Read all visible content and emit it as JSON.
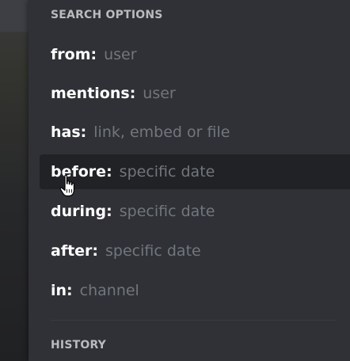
{
  "search_options": {
    "header": "SEARCH OPTIONS",
    "items": [
      {
        "key": "from:",
        "hint": "user"
      },
      {
        "key": "mentions:",
        "hint": "user"
      },
      {
        "key": "has:",
        "hint": "link, embed or file"
      },
      {
        "key": "before:",
        "hint": "specific date"
      },
      {
        "key": "during:",
        "hint": "specific date"
      },
      {
        "key": "after:",
        "hint": "specific date"
      },
      {
        "key": "in:",
        "hint": "channel"
      }
    ],
    "highlighted_index": 3
  },
  "history": {
    "header": "HISTORY"
  },
  "cursor": {
    "icon": "hand-pointer-icon"
  },
  "colors": {
    "panel_bg": "#2f3136",
    "highlight_bg": "#202225",
    "key_text": "#ffffff",
    "hint_text": "#72767d",
    "header_text": "#b9bbbe"
  }
}
